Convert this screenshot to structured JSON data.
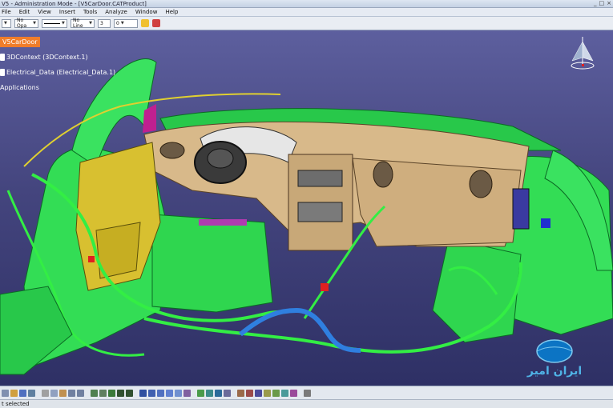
{
  "window": {
    "title": "V5 - Administration Mode - [V5CarDoor.CATProduct]",
    "controls": [
      "_",
      "□",
      "×"
    ]
  },
  "menu": {
    "items": [
      "File",
      "Edit",
      "View",
      "Insert",
      "Tools",
      "Analyze",
      "Window",
      "Help"
    ]
  },
  "toolbar_top": {
    "line_type_value": "",
    "opacity_value": "No Opa",
    "line_value": "No Line",
    "weight_value": "3",
    "layer_value": "0"
  },
  "tree": {
    "root_label": "V5CarDoor",
    "items": [
      "3DContext (3DContext.1)",
      "Electrical_Data (Electrical_Data.1)",
      "Applications"
    ]
  },
  "watermark": {
    "brand": "Iranamir",
    "persian": "ایران امیر"
  },
  "status": {
    "text": "t selected"
  },
  "colors": {
    "viewport_top": "#5d5f9e",
    "viewport_bottom": "#2e3065",
    "tree_highlight": "#f07d2a",
    "harness_green": "#33dd55",
    "dashboard_tan": "#d8b98a",
    "door_yellow": "#d8c030",
    "harness_blue": "#2f7fe0"
  }
}
